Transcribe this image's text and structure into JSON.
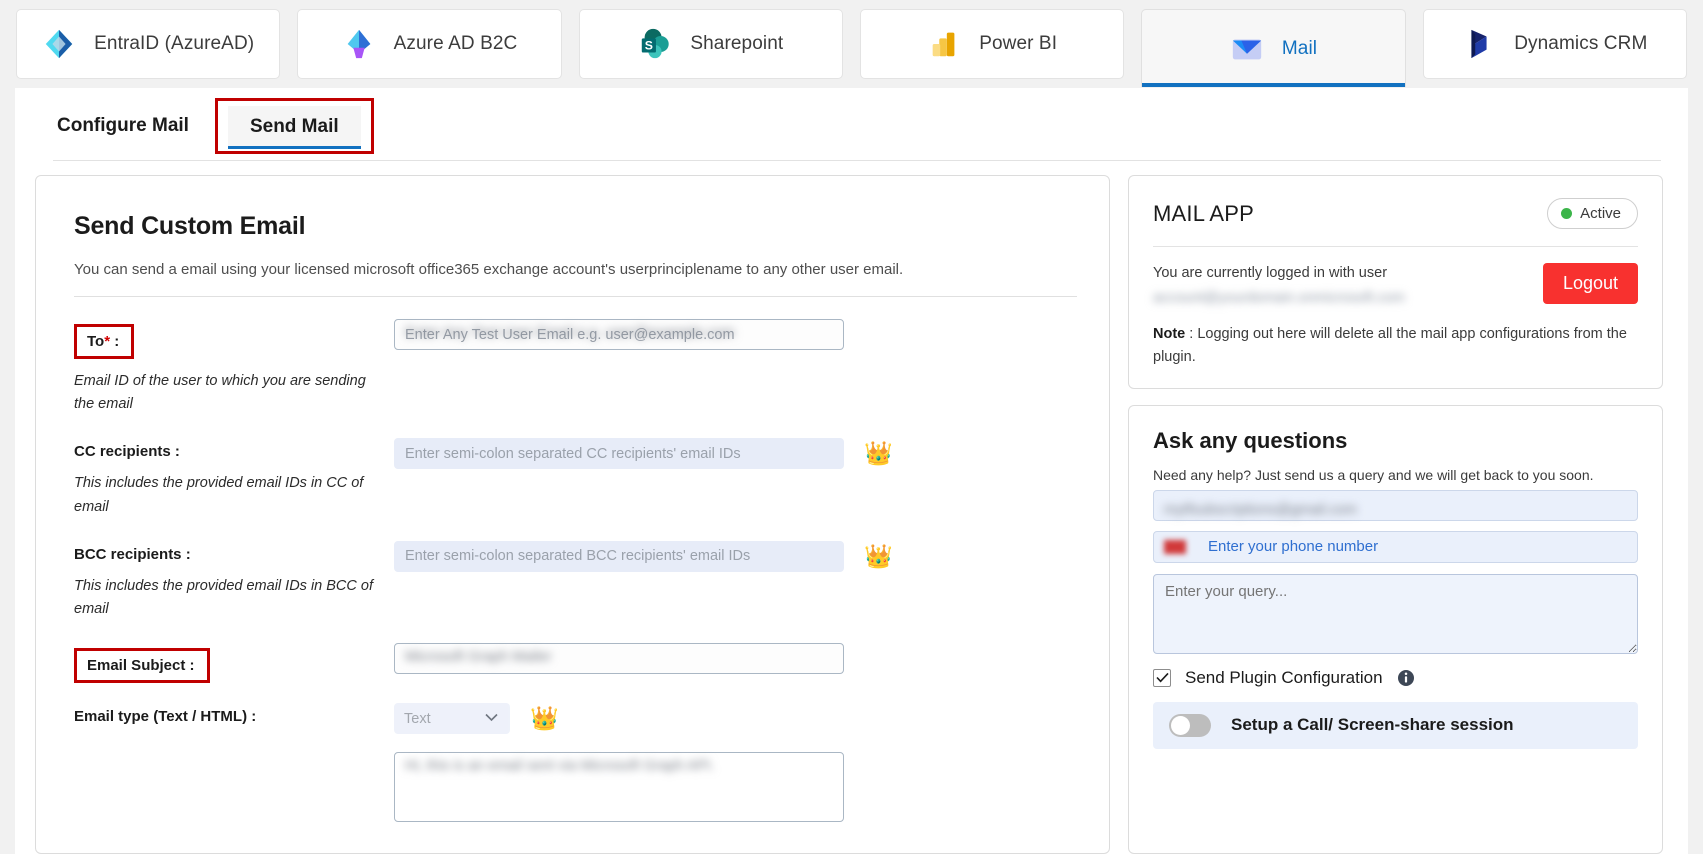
{
  "product_tabs": [
    {
      "label": "EntraID (AzureAD)",
      "icon": "entra-id-icon",
      "active": false
    },
    {
      "label": "Azure AD B2C",
      "icon": "azure-ad-b2c-icon",
      "active": false
    },
    {
      "label": "Sharepoint",
      "icon": "sharepoint-icon",
      "active": false
    },
    {
      "label": "Power BI",
      "icon": "power-bi-icon",
      "active": false
    },
    {
      "label": "Mail",
      "icon": "mail-icon",
      "active": true
    },
    {
      "label": "Dynamics CRM",
      "icon": "dynamics-crm-icon",
      "active": false
    }
  ],
  "sub_tabs": {
    "configure": "Configure Mail",
    "send": "Send Mail",
    "active": "Send Mail"
  },
  "main": {
    "title": "Send Custom Email",
    "description": "You can send a email using your licensed microsoft office365 exchange account's userprinciplename to any other user email.",
    "fields": {
      "to": {
        "label": "To",
        "required_mark": "*",
        "colon": " :",
        "hint": "Email ID of the user to which you are sending the email",
        "placeholder": "Enter Any Test User Email e.g. user@example.com",
        "value": "Enter Any Test User Email e.g. user@example.com",
        "redacted": true
      },
      "cc": {
        "label": "CC recipients :",
        "hint": "This includes the provided email IDs in CC of email",
        "placeholder": "Enter semi-colon separated CC recipients' email IDs",
        "value": "",
        "premium": true,
        "premium_icon": "crown-icon",
        "disabled": true
      },
      "bcc": {
        "label": "BCC recipients :",
        "hint": "This includes the provided email IDs in BCC of email",
        "placeholder": "Enter semi-colon separated BCC recipients' email IDs",
        "value": "",
        "premium": true,
        "premium_icon": "crown-icon",
        "disabled": true
      },
      "subject": {
        "label": "Email Subject :",
        "placeholder": "",
        "value": "Microsoft Graph Mailer",
        "redacted": true
      },
      "email_type": {
        "label": "Email type (Text / HTML) :",
        "selected": "Text",
        "options": [
          "Text",
          "HTML"
        ],
        "premium": true,
        "premium_icon": "crown-icon",
        "disabled": true
      },
      "body": {
        "value": "Hi, this is an email sent via Microsoft Graph API.",
        "redacted": true
      }
    }
  },
  "mail_app_panel": {
    "title": "MAIL APP",
    "status_label": "Active",
    "status_color": "#3cb54a",
    "logged_in_text": "You are currently logged in with user",
    "logged_in_user": "account@yourdomain.onmicrosoft.com",
    "logged_in_user_redacted": true,
    "logout_label": "Logout",
    "logout_color": "#f8312f",
    "note_prefix": "Note",
    "note_text": " : Logging out here will delete all the mail app configurations from the plugin."
  },
  "questions_panel": {
    "title": "Ask any questions",
    "subtitle": "Need any help? Just send us a query and we will get back to you soon.",
    "email_value": "mytfsubscriptions@gmail.com",
    "email_redacted": true,
    "phone_placeholder": "Enter your phone number",
    "phone_flag_icon": "country-flag-icon",
    "query_placeholder": "Enter your query...",
    "checkbox_label": "Send Plugin Configuration",
    "checkbox_checked": true,
    "info_icon": "info-icon",
    "toggle_label": "Setup a Call/ Screen-share session",
    "toggle_on": false
  }
}
